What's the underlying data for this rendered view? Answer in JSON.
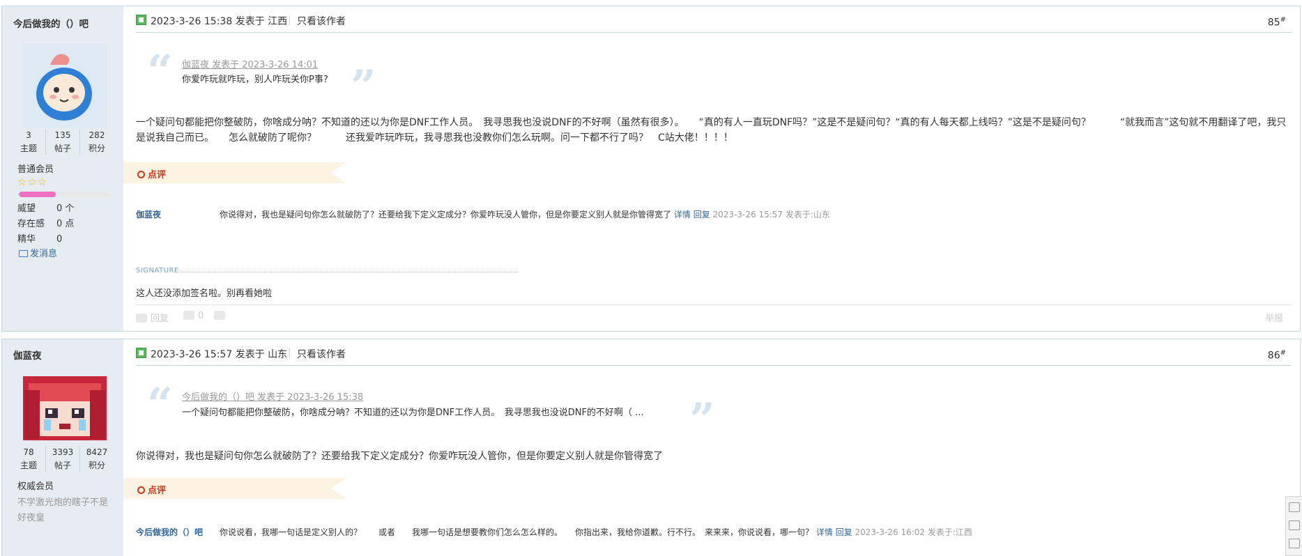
{
  "posts": [
    {
      "author": "今后做我的（）吧",
      "stats": [
        {
          "value": "3",
          "label": "主题"
        },
        {
          "value": "135",
          "label": "帖子"
        },
        {
          "value": "282",
          "label": "积分"
        }
      ],
      "rank": "普通会员",
      "stars": "☆☆☆",
      "progress": 0.4,
      "attributes": [
        {
          "key": "威望",
          "value": "0 个"
        },
        {
          "key": "存在感",
          "value": "0 点"
        },
        {
          "key": "精华",
          "value": "0"
        }
      ],
      "send_message": "发消息",
      "time": "2023-3-26 15:38 发表于 江西",
      "only_author": "只看该作者",
      "floor": "85",
      "floor_mark": "#",
      "quote_meta": "伽蓝夜 发表于 2023-3-26 14:01",
      "quote_text": "你爱咋玩就咋玩，别人咋玩关你P事?",
      "content": "一个疑问句都能把你整破防，你啥成分呐？不知道的还以为你是DNF工作人员。　我寻思我也没说DNF的不好啊（虽然有很多）。　　“真的有人一直玩DNF吗？”这是不是疑问句？“真的有人每天都上线吗？”这是不是疑问句？　　　“就我而言”这句就不用翻译了吧，我只是说我自己而已。　　怎么就破防了呢你？　　　还我爱咋玩咋玩，我寻思我也没教你们怎么玩啊。问一下都不行了吗？　C站大佬！！！！",
      "review_label": "点评",
      "comment": {
        "name": "伽蓝夜",
        "text": "你说得对，我也是疑问句你怎么就破防了？还要给我下定义定成分？你爱咋玩没人管你，但是你要定义别人就是你管得宽了",
        "detail": "详情",
        "reply": "回复",
        "time": "2023-3-26 15:57 发表于:山东"
      },
      "signature_label": "SIGNATURE",
      "signature_text": "这人还没添加签名啦。别再看她啦",
      "footer": {
        "reply": "回复",
        "like_count": "0",
        "report": "举报"
      }
    },
    {
      "author": "伽蓝夜",
      "stats": [
        {
          "value": "78",
          "label": "主题"
        },
        {
          "value": "3393",
          "label": "帖子"
        },
        {
          "value": "8427",
          "label": "积分"
        }
      ],
      "rank": "权威会员",
      "note": "不学激光炮的瞎子不是好夜皇",
      "time": "2023-3-26 15:57 发表于 山东",
      "only_author": "只看该作者",
      "floor": "86",
      "floor_mark": "#",
      "quote_meta": "今后做我的（）吧 发表于 2023-3-26 15:38",
      "quote_text": "一个疑问句都能把你整破防，你啥成分呐？不知道的还以为你是DNF工作人员。　我寻思我也没说DNF的不好啊（ ...",
      "content": "你说得对，我也是疑问句你怎么就破防了？还要给我下定义定成分？你爱咋玩没人管你，但是你要定义别人就是你管得宽了",
      "review_label": "点评",
      "comment": {
        "name": "今后做我的（）吧",
        "text": "你说说看，我哪一句话是定义别人的？　　或者　　我哪一句话是想要教你们怎么怎么样的。　　你指出来，我给你道歉。行不行。　来来来，你说说看，哪一句？",
        "detail": "详情",
        "reply": "回复",
        "time": "2023-3-26 16:02 发表于:江西"
      }
    }
  ]
}
